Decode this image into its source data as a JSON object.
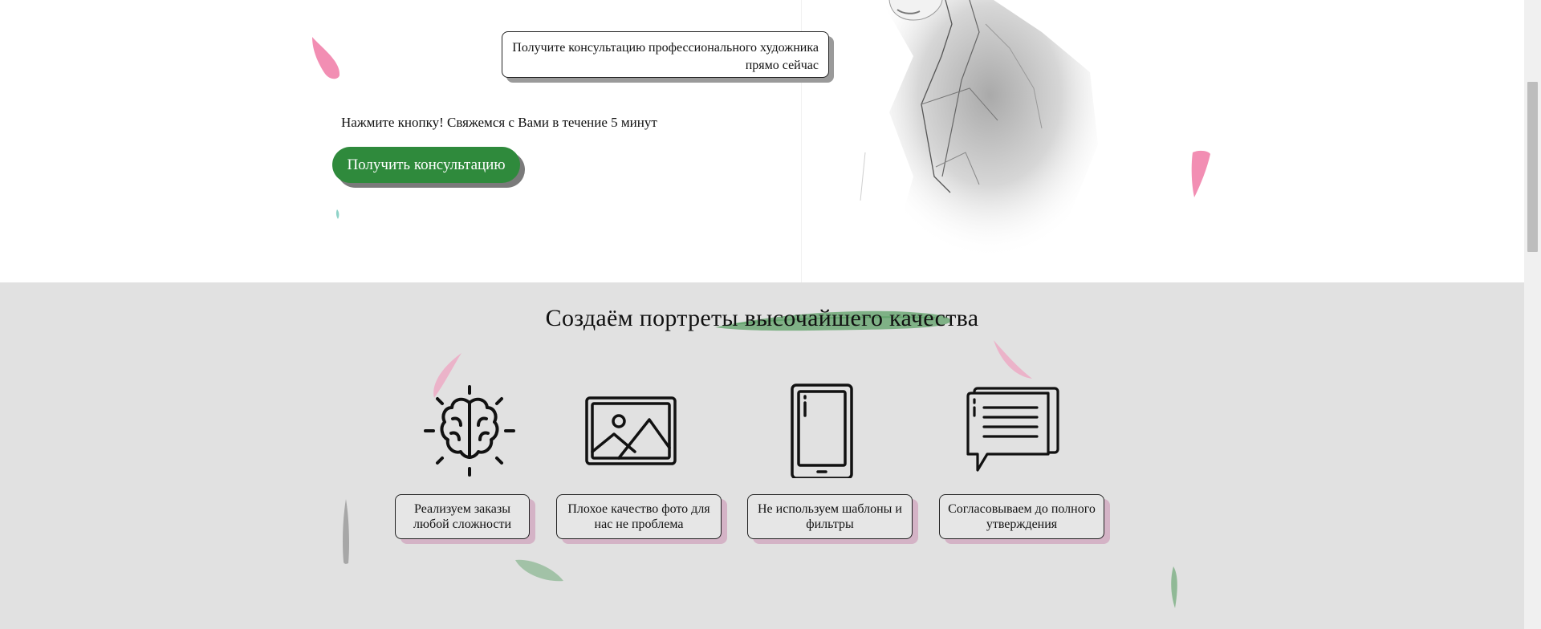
{
  "hero": {
    "bubble_text": "Получите консультацию профессионального художника прямо сейчас",
    "lead_text": "Нажмите кнопку! Свяжемся с Вами в течение 5 минут",
    "cta_label": "Получить консультацию"
  },
  "features_section": {
    "title": "Создаём портреты высочайшего качества",
    "items": [
      {
        "icon": "brain-icon",
        "label": "Реализуем заказы любой сложности"
      },
      {
        "icon": "image-frame-icon",
        "label": "Плохое качество фото для нас не проблема"
      },
      {
        "icon": "smartphone-icon",
        "label": "Не используем шаблоны и фильтры"
      },
      {
        "icon": "chat-bubbles-icon",
        "label": "Согласовываем до полного утверждения"
      }
    ]
  },
  "colors": {
    "accent_green": "#2f8a3c",
    "section_bg": "#e1e1e1",
    "petal_pink": "#f07aa6",
    "badge_shadow": "#d4b3c6"
  }
}
